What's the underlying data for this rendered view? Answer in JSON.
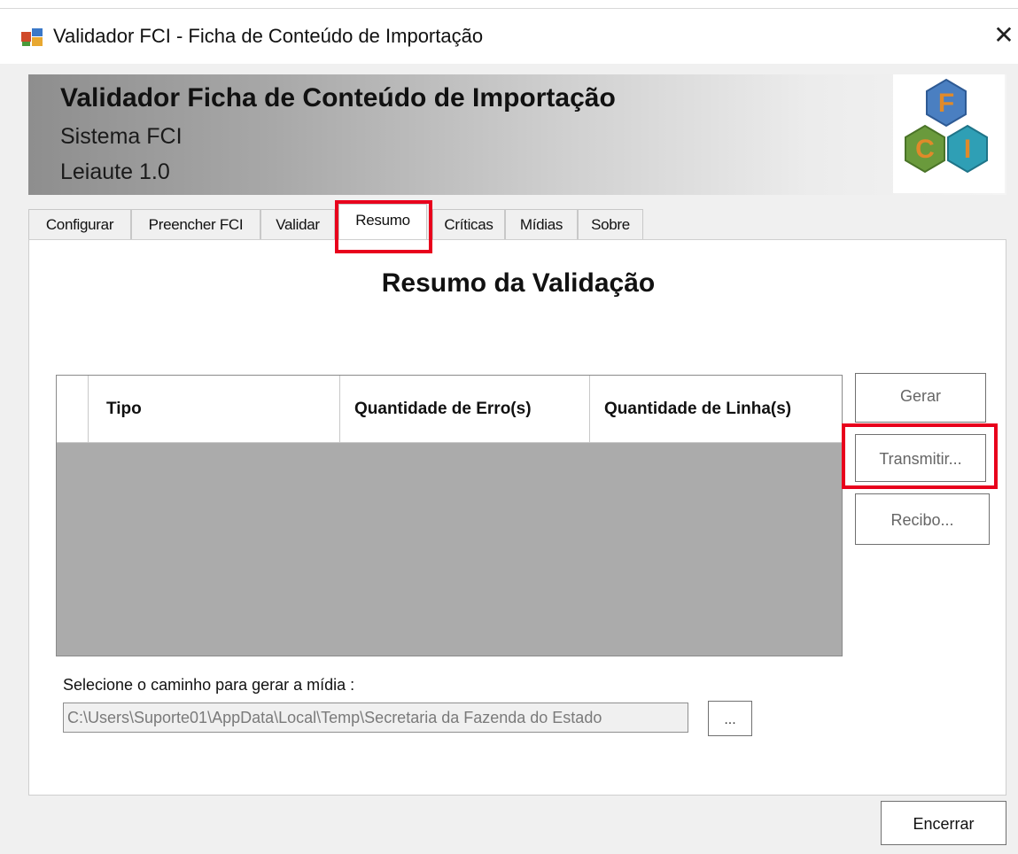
{
  "window": {
    "title": "Validador FCI - Ficha de Conteúdo de Importação",
    "icon": "app-window-icon",
    "close_icon": "close-icon",
    "close_glyph": "✕"
  },
  "banner": {
    "title": "Validador Ficha de Conteúdo de Importação",
    "subtitle1": "Sistema FCI",
    "subtitle2": "Leiaute 1.0",
    "logo": {
      "icon": "fci-hexagon-logo",
      "letter_f": "F",
      "letter_c": "C",
      "letter_i": "I",
      "colors": {
        "f": "#4a7fc1",
        "c": "#6a9a3c",
        "i": "#2f9fb5",
        "letter": "#e08a2a"
      }
    }
  },
  "tabs": [
    {
      "label": "Configurar",
      "active": false
    },
    {
      "label": "Preencher FCI",
      "active": false
    },
    {
      "label": "Validar",
      "active": false
    },
    {
      "label": "Resumo",
      "active": true
    },
    {
      "label": "Críticas",
      "active": false
    },
    {
      "label": "Mídias",
      "active": false
    },
    {
      "label": "Sobre",
      "active": false
    }
  ],
  "panel": {
    "title": "Resumo da Validação",
    "grid": {
      "columns": [
        "Tipo",
        "Quantidade de Erro(s)",
        "Quantidade de Linha(s)"
      ],
      "rows": []
    },
    "buttons": {
      "gerar": "Gerar",
      "transmitir": "Transmitir...",
      "recibo": "Recibo..."
    },
    "path": {
      "label": "Selecione o caminho para gerar a mídia :",
      "value": "C:\\Users\\Suporte01\\AppData\\Local\\Temp\\Secretaria da Fazenda do Estado",
      "browse_label": "..."
    }
  },
  "footer": {
    "encerrar": "Encerrar"
  },
  "highlight_color": "#e8001c"
}
